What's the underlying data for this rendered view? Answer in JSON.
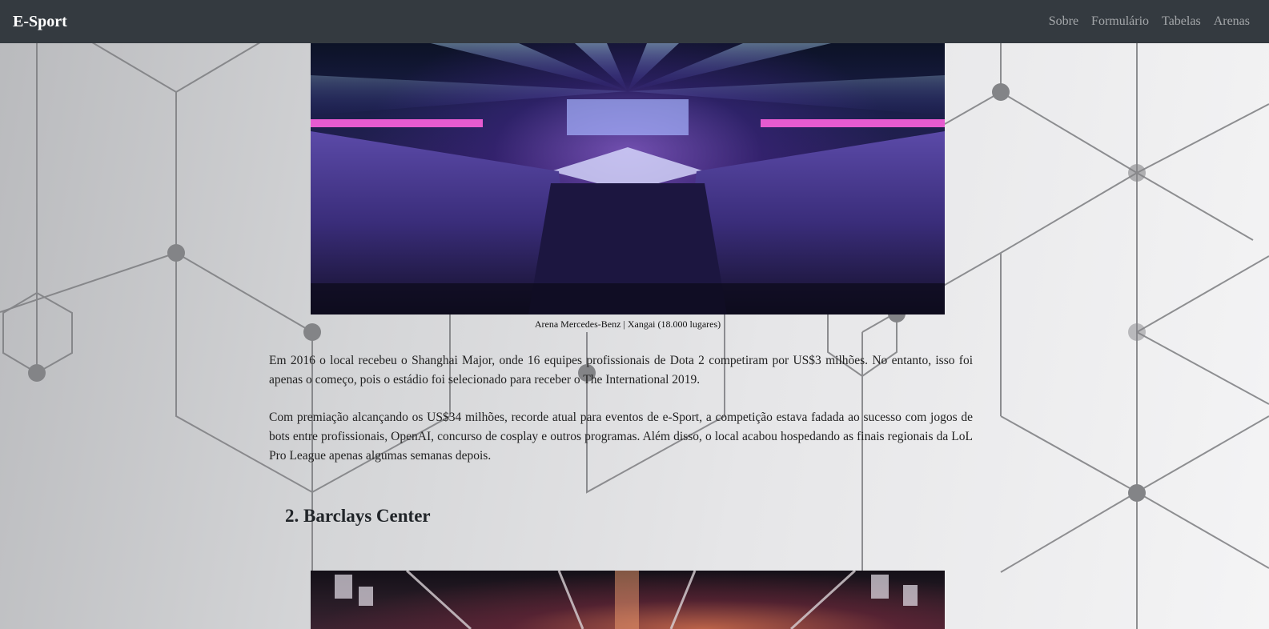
{
  "navbar": {
    "brand": "E-Sport",
    "links": [
      "Sobre",
      "Formulário",
      "Tabelas",
      "Arenas"
    ]
  },
  "section1": {
    "image_alt": "Arena Mercedes-Benz",
    "caption": "Arena Mercedes-Benz | Xangai (18.000 lugares)",
    "paragraphs": [
      "Em 2016 o local recebeu o Shanghai Major, onde 16 equipes profissionais de Dota 2 competiram por US$3 milhões. No entanto, isso foi apenas o começo, pois o estádio foi selecionado para receber o The International 2019.",
      "Com premiação alcançando os US$34 milhões, recorde atual para eventos de e-Sport, a competição estava fadada ao sucesso com jogos de bots entre profissionais, OpenAI, concurso de cosplay e outros programas. Além disso, o local acabou hospedando as finais regionais da LoL Pro League apenas algumas semanas depois."
    ]
  },
  "section2": {
    "heading": "2. Barclays Center",
    "image_alt": "Barclays Center"
  },
  "colors": {
    "navbar_bg": "#343a40",
    "brand": "#ffffff",
    "nav_link": "#9a9da0",
    "text": "#222222"
  }
}
